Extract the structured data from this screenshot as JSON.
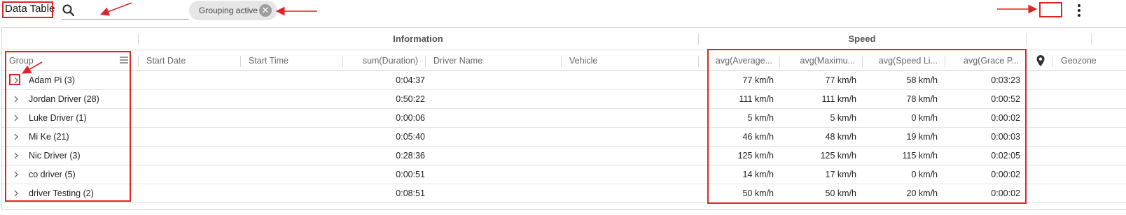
{
  "toolbar": {
    "title": "Data Table",
    "search_placeholder": "",
    "search_value": "",
    "chip_label": "Grouping active",
    "chip_close": "✕"
  },
  "column_groups": [
    "Information",
    "Speed"
  ],
  "columns": {
    "group": "Group",
    "start_date": "Start Date",
    "start_time": "Start Time",
    "duration": "sum(Duration)",
    "driver_name": "Driver Name",
    "vehicle": "Vehicle",
    "avg_speed": "avg(Average...",
    "max_speed": "avg(Maximu...",
    "speed_limit": "avg(Speed Li...",
    "grace": "avg(Grace P...",
    "geozone": "Geozone"
  },
  "rows": [
    {
      "group": "Adam Pi (3)",
      "duration": "0:04:37",
      "avg_speed": "77 km/h",
      "max_speed": "77 km/h",
      "speed_limit": "58 km/h",
      "grace": "0:03:23"
    },
    {
      "group": "Jordan Driver (28)",
      "duration": "0:50:22",
      "avg_speed": "111 km/h",
      "max_speed": "111 km/h",
      "speed_limit": "78 km/h",
      "grace": "0:00:52"
    },
    {
      "group": "Luke Driver (1)",
      "duration": "0:00:06",
      "avg_speed": "5 km/h",
      "max_speed": "5 km/h",
      "speed_limit": "0 km/h",
      "grace": "0:00:02"
    },
    {
      "group": "Mi Ke (21)",
      "duration": "0:05:40",
      "avg_speed": "46 km/h",
      "max_speed": "48 km/h",
      "speed_limit": "19 km/h",
      "grace": "0:00:03"
    },
    {
      "group": "Nic Driver (3)",
      "duration": "0:28:36",
      "avg_speed": "125 km/h",
      "max_speed": "125 km/h",
      "speed_limit": "115 km/h",
      "grace": "0:02:05"
    },
    {
      "group": "co driver (5)",
      "duration": "0:00:51",
      "avg_speed": "14 km/h",
      "max_speed": "17 km/h",
      "speed_limit": "0 km/h",
      "grace": "0:00:02"
    },
    {
      "group": "driver Testing (2)",
      "duration": "0:08:51",
      "avg_speed": "50 km/h",
      "max_speed": "50 km/h",
      "speed_limit": "20 km/h",
      "grace": "0:00:02"
    }
  ],
  "colors": {
    "annotation": "#e02424",
    "header_text": "#666666",
    "chip_bg": "#e6e6e6"
  }
}
